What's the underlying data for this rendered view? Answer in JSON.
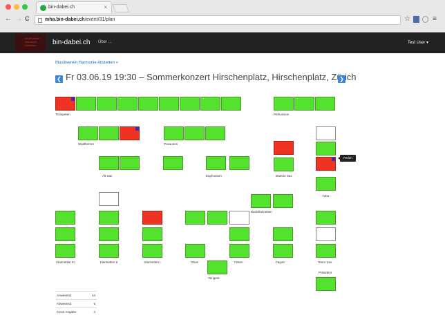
{
  "browser": {
    "tab_title": "bin-dabei.ch",
    "tab_close": "×",
    "url_host": "mha.bin-dabei.ch",
    "url_path": "/event/31/plan",
    "back": "←",
    "forward": "→",
    "reload": "C",
    "star": "☆",
    "menu": "≡"
  },
  "navbar": {
    "logo_text": "Musikverein Harmonie Altstetten",
    "brand": "bin-dabei.ch",
    "about": "Über ...",
    "user": "Test User ▾"
  },
  "breadcrumb": "Musikverein Harmonie Altstetten »",
  "event": {
    "title": "Fr 03.06.19 19:30 – Sommerkonzert Hirschenplatz, Hirschenplatz, Zürich",
    "prev": "❮",
    "next": "❯"
  },
  "tooltip": "Ferien",
  "sections": [
    {
      "id": "trompeten",
      "label": "Trompeten"
    },
    {
      "id": "perkussion",
      "label": "Perkussion"
    },
    {
      "id": "waldhoerner",
      "label": "Waldhörner"
    },
    {
      "id": "posaunen",
      "label": "Posaunen"
    },
    {
      "id": "altsax",
      "label": "Alt Sax"
    },
    {
      "id": "euphonium",
      "label": "Euphonium"
    },
    {
      "id": "bariton",
      "label": "Bariton Sax"
    },
    {
      "id": "tuba",
      "label": "Tuba"
    },
    {
      "id": "bassklar",
      "label": "Bassklarinetten"
    },
    {
      "id": "klar3",
      "label": "Klarinetten III"
    },
    {
      "id": "klar2",
      "label": "Klarinetten II"
    },
    {
      "id": "klar1",
      "label": "Klarinetten I"
    },
    {
      "id": "oboe",
      "label": "Oboe"
    },
    {
      "id": "floeten",
      "label": "Flöten"
    },
    {
      "id": "fagott",
      "label": "Fagott"
    },
    {
      "id": "tenorsax",
      "label": "Tenor Sax"
    },
    {
      "id": "dirigent",
      "label": "Dirigent"
    },
    {
      "id": "president",
      "label": "Präsident"
    }
  ],
  "seat_colors": {
    "present": "#55e22e",
    "absent": "#ee3322",
    "unknown": "#ffffff"
  },
  "stats": [
    {
      "label": "Anwesend",
      "value": "44"
    },
    {
      "label": "Abwesend",
      "value": "5"
    },
    {
      "label": "Keine Angabe",
      "value": "4"
    }
  ]
}
